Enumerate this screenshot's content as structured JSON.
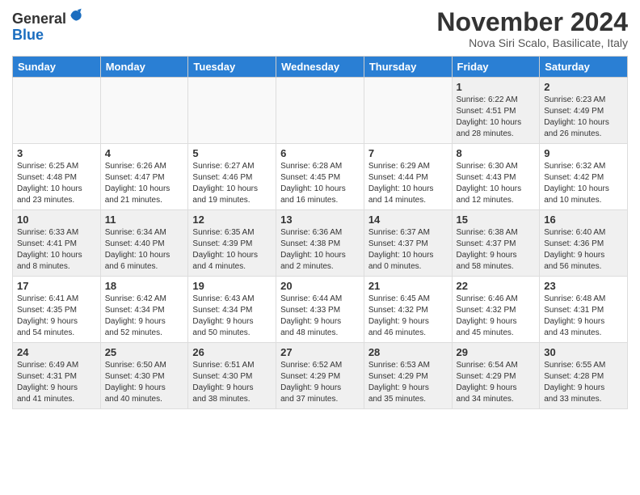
{
  "header": {
    "logo_line1": "General",
    "logo_line2": "Blue",
    "month_title": "November 2024",
    "location": "Nova Siri Scalo, Basilicate, Italy"
  },
  "weekdays": [
    "Sunday",
    "Monday",
    "Tuesday",
    "Wednesday",
    "Thursday",
    "Friday",
    "Saturday"
  ],
  "weeks": [
    [
      {
        "day": "",
        "info": ""
      },
      {
        "day": "",
        "info": ""
      },
      {
        "day": "",
        "info": ""
      },
      {
        "day": "",
        "info": ""
      },
      {
        "day": "",
        "info": ""
      },
      {
        "day": "1",
        "info": "Sunrise: 6:22 AM\nSunset: 4:51 PM\nDaylight: 10 hours\nand 28 minutes."
      },
      {
        "day": "2",
        "info": "Sunrise: 6:23 AM\nSunset: 4:49 PM\nDaylight: 10 hours\nand 26 minutes."
      }
    ],
    [
      {
        "day": "3",
        "info": "Sunrise: 6:25 AM\nSunset: 4:48 PM\nDaylight: 10 hours\nand 23 minutes."
      },
      {
        "day": "4",
        "info": "Sunrise: 6:26 AM\nSunset: 4:47 PM\nDaylight: 10 hours\nand 21 minutes."
      },
      {
        "day": "5",
        "info": "Sunrise: 6:27 AM\nSunset: 4:46 PM\nDaylight: 10 hours\nand 19 minutes."
      },
      {
        "day": "6",
        "info": "Sunrise: 6:28 AM\nSunset: 4:45 PM\nDaylight: 10 hours\nand 16 minutes."
      },
      {
        "day": "7",
        "info": "Sunrise: 6:29 AM\nSunset: 4:44 PM\nDaylight: 10 hours\nand 14 minutes."
      },
      {
        "day": "8",
        "info": "Sunrise: 6:30 AM\nSunset: 4:43 PM\nDaylight: 10 hours\nand 12 minutes."
      },
      {
        "day": "9",
        "info": "Sunrise: 6:32 AM\nSunset: 4:42 PM\nDaylight: 10 hours\nand 10 minutes."
      }
    ],
    [
      {
        "day": "10",
        "info": "Sunrise: 6:33 AM\nSunset: 4:41 PM\nDaylight: 10 hours\nand 8 minutes."
      },
      {
        "day": "11",
        "info": "Sunrise: 6:34 AM\nSunset: 4:40 PM\nDaylight: 10 hours\nand 6 minutes."
      },
      {
        "day": "12",
        "info": "Sunrise: 6:35 AM\nSunset: 4:39 PM\nDaylight: 10 hours\nand 4 minutes."
      },
      {
        "day": "13",
        "info": "Sunrise: 6:36 AM\nSunset: 4:38 PM\nDaylight: 10 hours\nand 2 minutes."
      },
      {
        "day": "14",
        "info": "Sunrise: 6:37 AM\nSunset: 4:37 PM\nDaylight: 10 hours\nand 0 minutes."
      },
      {
        "day": "15",
        "info": "Sunrise: 6:38 AM\nSunset: 4:37 PM\nDaylight: 9 hours\nand 58 minutes."
      },
      {
        "day": "16",
        "info": "Sunrise: 6:40 AM\nSunset: 4:36 PM\nDaylight: 9 hours\nand 56 minutes."
      }
    ],
    [
      {
        "day": "17",
        "info": "Sunrise: 6:41 AM\nSunset: 4:35 PM\nDaylight: 9 hours\nand 54 minutes."
      },
      {
        "day": "18",
        "info": "Sunrise: 6:42 AM\nSunset: 4:34 PM\nDaylight: 9 hours\nand 52 minutes."
      },
      {
        "day": "19",
        "info": "Sunrise: 6:43 AM\nSunset: 4:34 PM\nDaylight: 9 hours\nand 50 minutes."
      },
      {
        "day": "20",
        "info": "Sunrise: 6:44 AM\nSunset: 4:33 PM\nDaylight: 9 hours\nand 48 minutes."
      },
      {
        "day": "21",
        "info": "Sunrise: 6:45 AM\nSunset: 4:32 PM\nDaylight: 9 hours\nand 46 minutes."
      },
      {
        "day": "22",
        "info": "Sunrise: 6:46 AM\nSunset: 4:32 PM\nDaylight: 9 hours\nand 45 minutes."
      },
      {
        "day": "23",
        "info": "Sunrise: 6:48 AM\nSunset: 4:31 PM\nDaylight: 9 hours\nand 43 minutes."
      }
    ],
    [
      {
        "day": "24",
        "info": "Sunrise: 6:49 AM\nSunset: 4:31 PM\nDaylight: 9 hours\nand 41 minutes."
      },
      {
        "day": "25",
        "info": "Sunrise: 6:50 AM\nSunset: 4:30 PM\nDaylight: 9 hours\nand 40 minutes."
      },
      {
        "day": "26",
        "info": "Sunrise: 6:51 AM\nSunset: 4:30 PM\nDaylight: 9 hours\nand 38 minutes."
      },
      {
        "day": "27",
        "info": "Sunrise: 6:52 AM\nSunset: 4:29 PM\nDaylight: 9 hours\nand 37 minutes."
      },
      {
        "day": "28",
        "info": "Sunrise: 6:53 AM\nSunset: 4:29 PM\nDaylight: 9 hours\nand 35 minutes."
      },
      {
        "day": "29",
        "info": "Sunrise: 6:54 AM\nSunset: 4:29 PM\nDaylight: 9 hours\nand 34 minutes."
      },
      {
        "day": "30",
        "info": "Sunrise: 6:55 AM\nSunset: 4:28 PM\nDaylight: 9 hours\nand 33 minutes."
      }
    ]
  ]
}
